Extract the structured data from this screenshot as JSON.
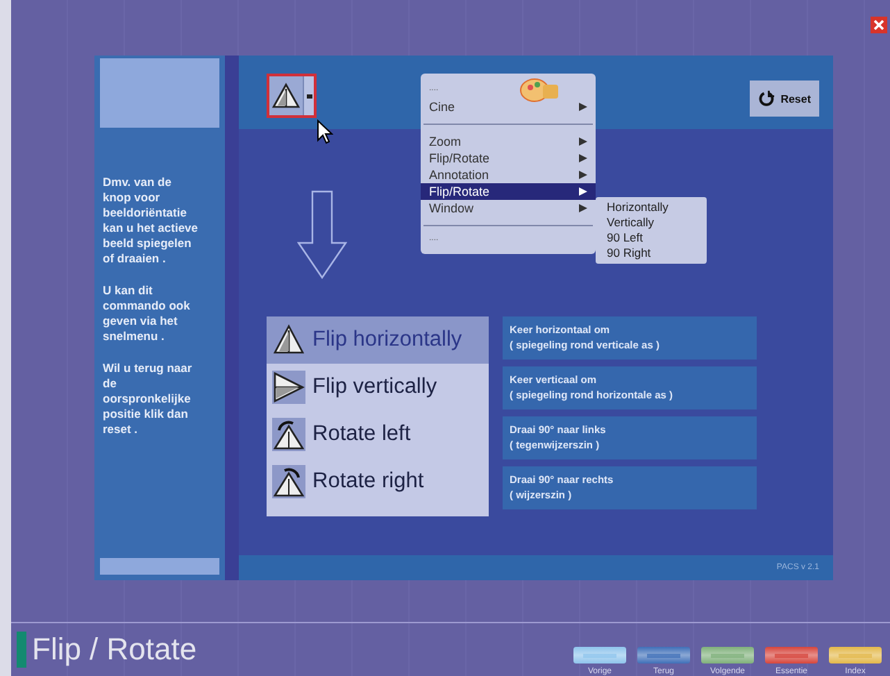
{
  "sidebar": {
    "paragraphs": [
      "Dmv. van de knop voor beeldoriëntatie kan u het actieve beeld spiegelen of draaien .",
      "U kan dit commando ook geven via het snelmenu .",
      "Wil u terug naar de oorspronkelijke positie klik dan reset ."
    ]
  },
  "toolbar": {
    "flip_button": {
      "highlighted": true
    }
  },
  "reset_button": {
    "label": "Reset"
  },
  "context_menu": {
    "items": [
      {
        "kind": "header",
        "label": "...."
      },
      {
        "kind": "item",
        "label": "Cine",
        "submenu": true,
        "selected": false
      },
      {
        "kind": "separator"
      },
      {
        "kind": "item",
        "label": "Zoom",
        "submenu": true,
        "selected": false
      },
      {
        "kind": "item",
        "label": "Flip/Rotate",
        "submenu": true,
        "selected": false
      },
      {
        "kind": "item",
        "label": "Annotation",
        "submenu": true,
        "selected": false
      },
      {
        "kind": "item",
        "label": "Flip/Rotate",
        "submenu": true,
        "selected": true
      },
      {
        "kind": "item",
        "label": "Window",
        "submenu": true,
        "selected": false
      },
      {
        "kind": "separator"
      },
      {
        "kind": "header",
        "label": "...."
      }
    ],
    "submenu": [
      "Horizontally",
      "Vertically",
      "90 Left",
      "90 Right"
    ]
  },
  "options": [
    {
      "kind": "flip-h",
      "label": "Flip horizontally",
      "selected": true,
      "description": [
        "Keer horizontaal om",
        "( spiegeling rond verticale as )"
      ]
    },
    {
      "kind": "flip-v",
      "label": "Flip vertically",
      "selected": false,
      "description": [
        "Keer verticaal om",
        "( spiegeling rond horizontale as )"
      ]
    },
    {
      "kind": "rotate-left",
      "label": "Rotate left",
      "selected": false,
      "description": [
        "Draai 90° naar links",
        "( tegenwijzerszin )"
      ]
    },
    {
      "kind": "rotate-right",
      "label": "Rotate right",
      "selected": false,
      "description": [
        "Draai 90° naar rechts",
        "( wijzerszin )"
      ]
    }
  ],
  "footer": {
    "text": "PACS v 2.1"
  },
  "page_title": "Flip / Rotate",
  "nav_buttons": [
    {
      "label": "Vorige",
      "color": "#8fc4ec"
    },
    {
      "label": "Terug",
      "color": "#3f6fb8"
    },
    {
      "label": "Volgende",
      "color": "#7fb07a"
    },
    {
      "label": "Essentie",
      "color": "#d6453c"
    },
    {
      "label": "Index",
      "color": "#e3b84a"
    }
  ]
}
